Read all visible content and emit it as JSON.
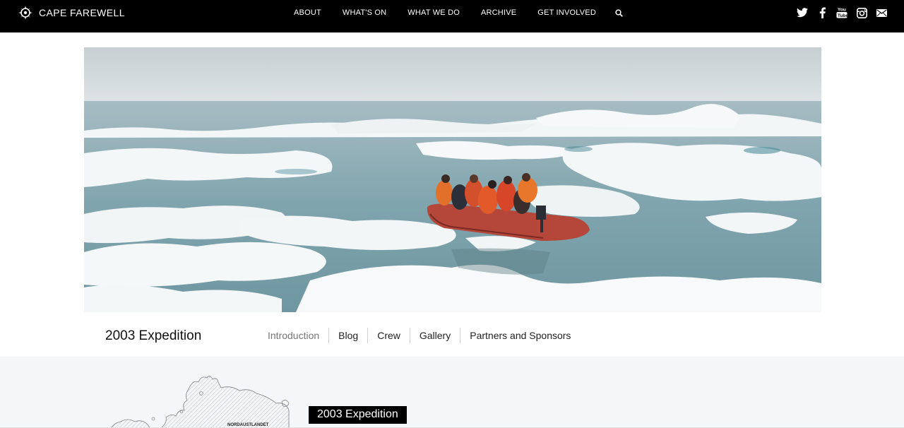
{
  "brand": {
    "name": "CAPE FAREWELL",
    "logo_icon": "compass-star-logo-icon"
  },
  "nav": {
    "items": [
      {
        "label": "ABOUT"
      },
      {
        "label": "WHAT'S ON"
      },
      {
        "label": "WHAT WE DO"
      },
      {
        "label": "ARCHIVE"
      },
      {
        "label": "GET INVOLVED"
      }
    ],
    "search_icon": "search-icon"
  },
  "social": [
    "twitter-icon",
    "facebook-icon",
    "youtube-icon",
    "instagram-icon",
    "mail-icon"
  ],
  "hero": {
    "alt": "Expedition members in an orange inflatable boat among Arctic sea ice"
  },
  "subnav": {
    "title": "2003 Expedition",
    "tabs": [
      {
        "label": "Introduction",
        "active": true
      },
      {
        "label": "Blog",
        "active": false
      },
      {
        "label": "Crew",
        "active": false
      },
      {
        "label": "Gallery",
        "active": false
      },
      {
        "label": "Partners and Sponsors",
        "active": false
      }
    ]
  },
  "content": {
    "heading": "2003 Expedition",
    "map_label": "NORDAUSTLANDET"
  },
  "colors": {
    "topbar": "#000000",
    "content_bg": "#f5f6f7",
    "active_tab": "#777777"
  }
}
